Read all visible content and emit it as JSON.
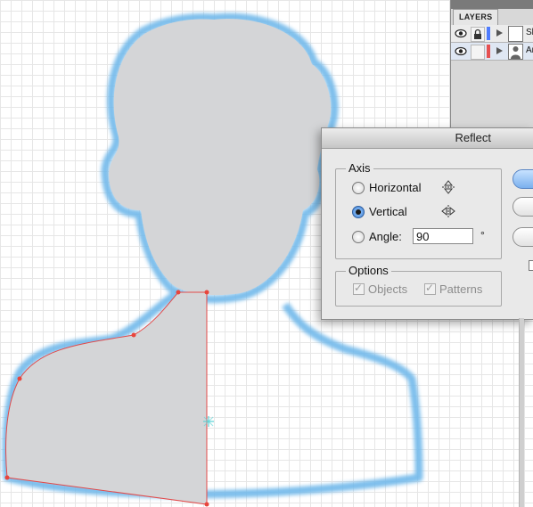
{
  "layers_panel": {
    "tab_label": "LAYERS",
    "layers": [
      {
        "name": "Sk",
        "color": "#4f7cff"
      },
      {
        "name": "Ar",
        "color": "#e65050"
      }
    ]
  },
  "reflect_dialog": {
    "title": "Reflect",
    "axis": {
      "group_label": "Axis",
      "horizontal_label": "Horizontal",
      "vertical_label": "Vertical",
      "angle_label": "Angle:",
      "angle_value": "90",
      "degree_symbol": "°",
      "selected": "Vertical"
    },
    "options": {
      "group_label": "Options",
      "objects_label": "Objects",
      "patterns_label": "Patterns"
    }
  },
  "colors": {
    "silhouette_fill": "#d4d5d7",
    "outline_glow": "#6fb8ea",
    "path_stroke": "#e24a4a",
    "anchor_point": "#e8453c"
  },
  "icons": [
    "eye-icon",
    "lock-icon",
    "expand-arrow-icon",
    "reflect-horizontal-icon",
    "reflect-vertical-icon"
  ]
}
